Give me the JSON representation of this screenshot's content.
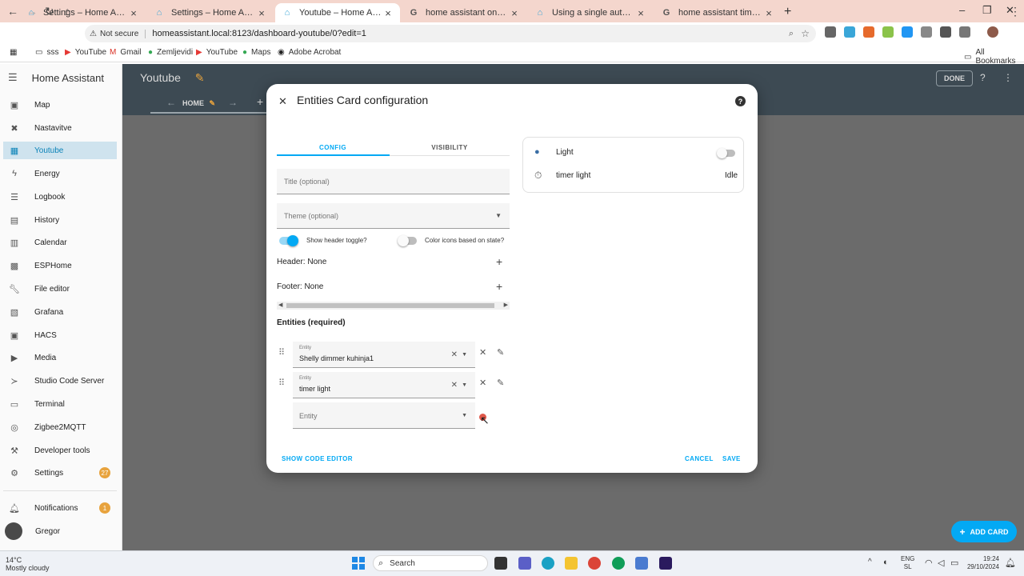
{
  "browser": {
    "tabs": [
      {
        "title": "Settings – Home Assistant",
        "icon": "home-assistant-icon"
      },
      {
        "title": "Settings – Home Assistant",
        "icon": "home-assistant-icon"
      },
      {
        "title": "Youtube – Home Assistant",
        "icon": "home-assistant-icon",
        "active": true
      },
      {
        "title": "home assistant one automatio",
        "icon": "google-icon"
      },
      {
        "title": "Using a single automation for e",
        "icon": "home-assistant-icon"
      },
      {
        "title": "home assistant timer.finished e",
        "icon": "google-icon"
      }
    ],
    "new_tab": "+",
    "window": {
      "minimize": "–",
      "restore": "❐",
      "close": "✕"
    },
    "security_label": "Not secure",
    "url": "homeassistant.local:8123/dashboard-youtube/0?edit=1",
    "bookmarks": [
      {
        "label": "sss",
        "icon": "folder-icon"
      },
      {
        "label": "YouTube",
        "icon": "youtube-icon"
      },
      {
        "label": "Gmail",
        "icon": "gmail-icon"
      },
      {
        "label": "Zemljevidi",
        "icon": "maps-icon"
      },
      {
        "label": "YouTube",
        "icon": "youtube-icon"
      },
      {
        "label": "Maps",
        "icon": "maps-icon"
      },
      {
        "label": "Adobe Acrobat",
        "icon": "acrobat-icon"
      }
    ],
    "all_bookmarks": "All Bookmarks"
  },
  "sidebar": {
    "title": "Home Assistant",
    "items": [
      {
        "label": "Map",
        "icon": "map-icon"
      },
      {
        "label": "Nastavitve",
        "icon": "tools-icon"
      },
      {
        "label": "Youtube",
        "icon": "dashboard-icon",
        "selected": true
      },
      {
        "label": "Energy",
        "icon": "lightning-icon"
      },
      {
        "label": "Logbook",
        "icon": "list-icon"
      },
      {
        "label": "History",
        "icon": "chart-icon"
      },
      {
        "label": "Calendar",
        "icon": "calendar-icon"
      },
      {
        "label": "ESPHome",
        "icon": "esphome-icon"
      },
      {
        "label": "File editor",
        "icon": "wrench-icon"
      },
      {
        "label": "Grafana",
        "icon": "grafana-icon"
      },
      {
        "label": "HACS",
        "icon": "hacs-icon"
      },
      {
        "label": "Media",
        "icon": "media-icon"
      },
      {
        "label": "Studio Code Server",
        "icon": "code-icon"
      },
      {
        "label": "Terminal",
        "icon": "terminal-icon"
      },
      {
        "label": "Zigbee2MQTT",
        "icon": "zigbee-icon"
      },
      {
        "label": "Developer tools",
        "icon": "hammer-icon"
      },
      {
        "label": "Settings",
        "icon": "gear-icon",
        "badge": "27"
      }
    ],
    "notifications": {
      "label": "Notifications",
      "badge": "1"
    },
    "user": "Gregor"
  },
  "dashboard": {
    "title": "Youtube",
    "done_label": "DONE",
    "view_tab": "HOME",
    "add_card_label": "ADD CARD"
  },
  "dialog": {
    "title": "Entities Card configuration",
    "tabs": [
      "CONFIG",
      "VISIBILITY"
    ],
    "title_placeholder": "Title (optional)",
    "theme_placeholder": "Theme (optional)",
    "show_header_toggle_label": "Show header toggle?",
    "show_header_toggle_on": true,
    "color_icons_label": "Color icons based on state?",
    "color_icons_on": false,
    "header_label": "Header: None",
    "footer_label": "Footer: None",
    "entities_heading": "Entities (required)",
    "entity_field_label": "Entity",
    "entities": [
      {
        "value": "Shelly dimmer kuhinja1"
      },
      {
        "value": "timer light"
      }
    ],
    "new_entity_placeholder": "Entity",
    "show_code_editor": "SHOW CODE EDITOR",
    "cancel": "CANCEL",
    "save": "SAVE"
  },
  "preview": {
    "rows": [
      {
        "name": "Light",
        "state": "",
        "icon": "bulb-icon",
        "toggle": false
      },
      {
        "name": "timer light",
        "state": "Idle",
        "icon": "timer-icon"
      }
    ]
  },
  "taskbar": {
    "weather_temp": "14°C",
    "weather_desc": "Mostly cloudy",
    "search_label": "Search",
    "lang_top": "ENG",
    "lang_bottom": "SL",
    "time": "19:24",
    "date": "29/10/2024"
  },
  "colors": {
    "accent": "#03a9f4",
    "header": "#3d4a53",
    "tab_strip": "#f4d6cd",
    "badge": "#e8a33d"
  }
}
